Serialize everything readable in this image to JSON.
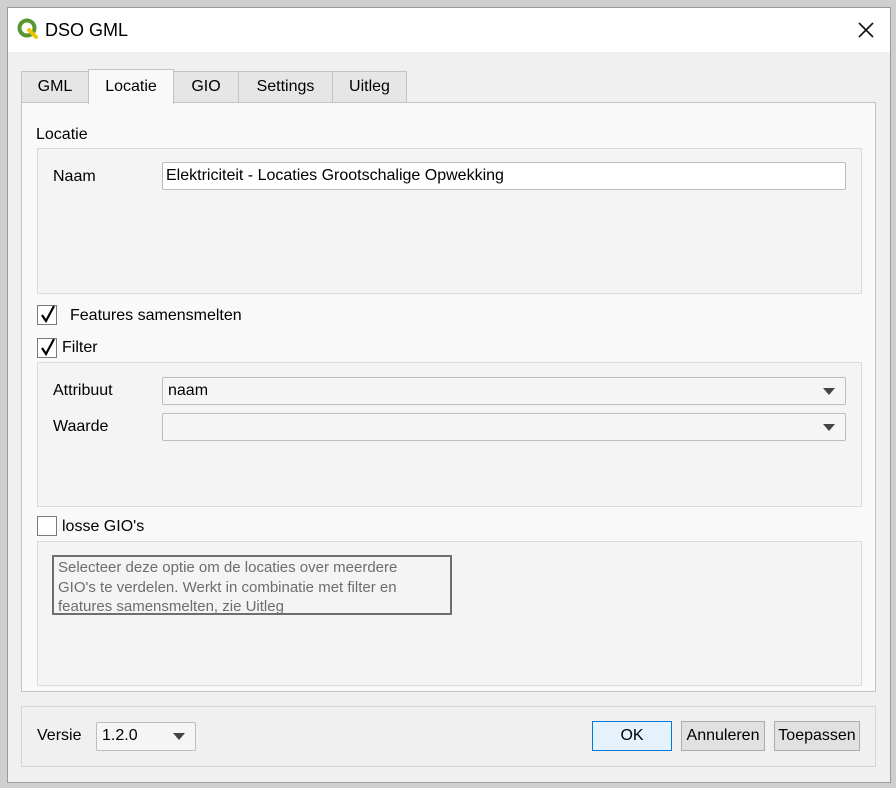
{
  "window": {
    "title": "DSO GML",
    "close_label": "✕"
  },
  "tabs": [
    {
      "label": "GML",
      "active": false
    },
    {
      "label": "Locatie",
      "active": true
    },
    {
      "label": "GIO",
      "active": false
    },
    {
      "label": "Settings",
      "active": false
    },
    {
      "label": "Uitleg",
      "active": false
    }
  ],
  "locatie": {
    "section_label": "Locatie",
    "naam_label": "Naam",
    "naam_value": "Elektriciteit - Locaties Grootschalige Opwekking"
  },
  "features_samensmelten": {
    "label": "Features samensmelten",
    "checked": true
  },
  "filter": {
    "label": "Filter",
    "checked": true,
    "attribuut_label": "Attribuut",
    "attribuut_value": "naam",
    "waarde_label": "Waarde",
    "waarde_value": ""
  },
  "losse_gios": {
    "label": "losse GIO's",
    "checked": false,
    "help_lines": [
      "Selecteer deze optie om de locaties over meerdere",
      "GIO's te verdelen. Werkt in combinatie met filter en",
      "features samensmelten, zie Uitleg"
    ]
  },
  "footer": {
    "versie_label": "Versie",
    "versie_value": "1.2.0",
    "ok_label": "OK",
    "annuleren_label": "Annuleren",
    "toepassen_label": "Toepassen"
  },
  "colors": {
    "accent": "#0078d7",
    "qgis_green": "#589632"
  }
}
